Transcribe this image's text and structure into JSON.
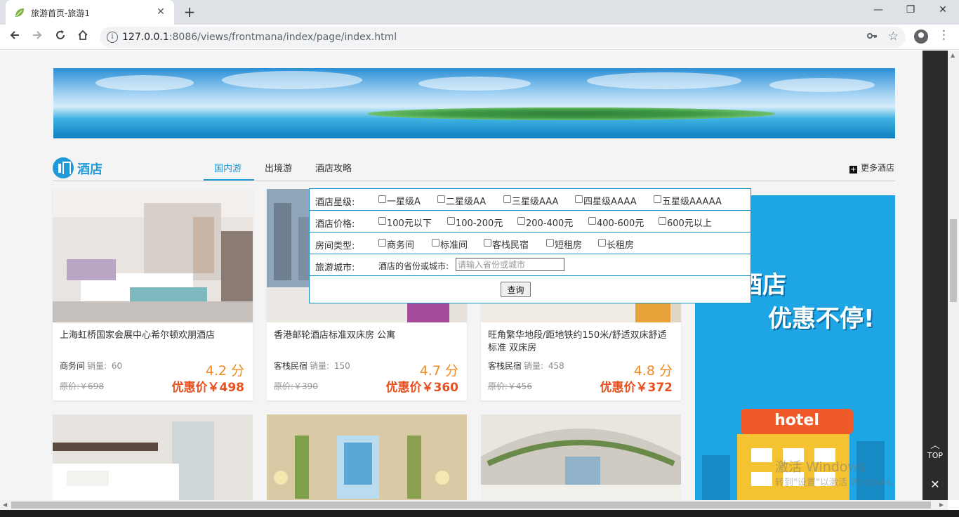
{
  "browser": {
    "tab_title": "旅游首页-旅游1",
    "tab_close": "✕",
    "new_tab": "+",
    "url_host": "127.0.0.1",
    "url_rest": ":8086/views/frontmana/index/page/index.html",
    "window_controls": [
      "—",
      "❐",
      "✕"
    ]
  },
  "section": {
    "title": "酒店",
    "tabs": [
      "国内游",
      "出境游",
      "酒店攻略"
    ],
    "active_tab": 0,
    "more": "更多酒店"
  },
  "filter": {
    "star": {
      "label": "酒店星级:",
      "options": [
        "一星级A",
        "二星级AA",
        "三星级AAA",
        "四星级AAAA",
        "五星级AAAAA"
      ]
    },
    "price": {
      "label": "酒店价格:",
      "options": [
        "100元以下",
        "100-200元",
        "200-400元",
        "400-600元",
        "600元以上"
      ]
    },
    "room": {
      "label": "房间类型:",
      "options": [
        "商务间",
        "标准间",
        "客栈民宿",
        "短租房",
        "长租房"
      ]
    },
    "city": {
      "label": "旅游城市:",
      "hint": "酒店的省份或城市:",
      "placeholder": "请输入省份或城市"
    },
    "submit": "查询"
  },
  "hotels": [
    {
      "name": "上海虹桥国家会展中心希尔顿欢朋酒店",
      "type": "商务间",
      "sales_label": "销量:",
      "sales": "60",
      "score": "4.2 分",
      "orig": "原价:￥698",
      "price": "优惠价￥498"
    },
    {
      "name": "香港邮轮酒店标准双床房 公寓",
      "type": "客栈民宿",
      "sales_label": "销量:",
      "sales": "150",
      "score": "4.7 分",
      "orig": "原价:￥390",
      "price": "优惠价￥360"
    },
    {
      "name": "旺角繁华地段/距地铁约150米/舒适双床舒适 标准 双床房",
      "type": "客栈民宿",
      "sales_label": "销量:",
      "sales": "458",
      "score": "4.8 分",
      "orig": "原价:￥456",
      "price": "优惠价￥372"
    }
  ],
  "promo": {
    "line1": "酒店",
    "line2": "优惠不停!",
    "sign": "hotel"
  },
  "side": {
    "top": "TOP",
    "close": "✕"
  },
  "watermark": {
    "line1": "激活 Windows",
    "line2": "转到\"设置\"以激活 Windows。"
  },
  "colors": {
    "accent": "#1f9ad6",
    "price": "#e8501f",
    "score": "#f08a24",
    "promo_bg": "#1ea5e6"
  },
  "icons": [
    "leaf-favicon-icon",
    "back-icon",
    "forward-icon",
    "reload-icon",
    "home-icon",
    "info-icon",
    "key-icon",
    "star-icon",
    "profile-icon",
    "menu-icon",
    "building-icon",
    "plus-icon",
    "arrow-up-icon",
    "close-icon"
  ]
}
